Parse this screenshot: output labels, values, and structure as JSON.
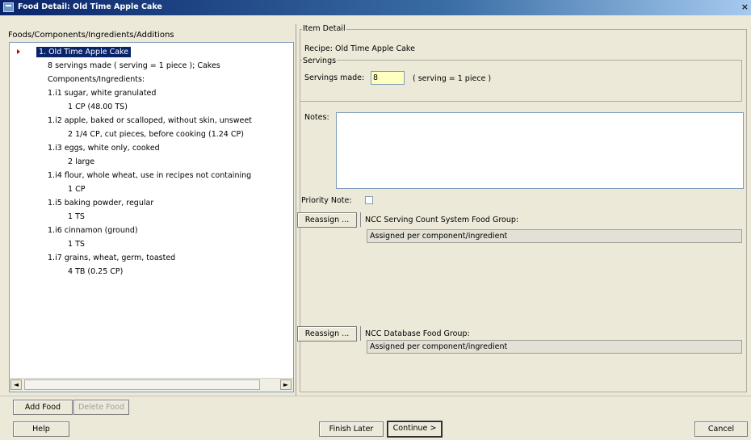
{
  "window": {
    "title": "Food Detail:  Old Time Apple Cake"
  },
  "tree": {
    "header": "Foods/Components/Ingredients/Additions",
    "selected": "1.  Old Time Apple Cake",
    "rows": [
      "8 servings made ( serving = 1 piece ); Cakes",
      "Components/Ingredients:",
      "1.i1  sugar, white granulated",
      "1 CP (48.00 TS)",
      "1.i2  apple, baked or scalloped, without skin, unsweet",
      "2 1/4 CP, cut pieces, before cooking (1.24 CP)",
      "1.i3  eggs, white only, cooked",
      "2 large",
      "1.i4  flour, whole wheat, use in recipes not containing",
      "1 CP",
      "1.i5  baking powder, regular",
      "1 TS",
      "1.i6  cinnamon (ground)",
      "1 TS",
      "1.i7  grains, wheat, germ, toasted",
      "4 TB (0.25 CP)"
    ]
  },
  "detail": {
    "group_label": "Item Detail",
    "recipe_line": "Recipe: Old Time Apple Cake",
    "servings_group": "Servings",
    "servings_label": "Servings made:",
    "servings_value": "8",
    "serving_desc": "( serving = 1 piece )",
    "notes_label": "Notes:",
    "priority_label": "Priority Note:"
  },
  "groups": {
    "reassign1": "Reassign ...",
    "serving_count_label": "NCC Serving Count System Food Group:",
    "serving_count_value": "Assigned per component/ingredient",
    "reassign2": "Reassign ...",
    "database_label": "NCC Database Food Group:",
    "database_value": "Assigned per component/ingredient"
  },
  "buttons": {
    "add_food": "Add Food",
    "delete_food": "Delete Food",
    "help": "Help",
    "finish_later": "Finish Later",
    "continue": "Continue >",
    "cancel": "Cancel"
  },
  "scroll": {
    "left": "◄",
    "right": "►"
  }
}
